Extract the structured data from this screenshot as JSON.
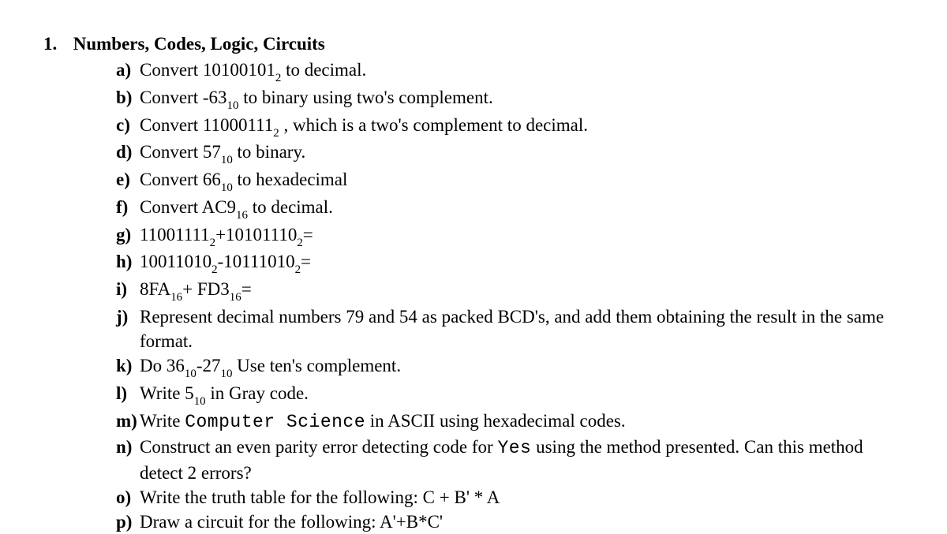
{
  "section": {
    "number": "1.",
    "title": "Numbers, Codes, Logic, Circuits"
  },
  "items": {
    "a": {
      "label": "a)",
      "pre": "Convert 10100101",
      "sub1": "2",
      "post": " to decimal."
    },
    "b": {
      "label": "b)",
      "pre": "Convert -63",
      "sub1": "10",
      "post": " to binary using two's complement."
    },
    "c": {
      "label": "c)",
      "pre": "Convert 11000111",
      "sub1": "2",
      "post": " , which is a  two's complement to decimal."
    },
    "d": {
      "label": "d)",
      "pre": "Convert 57",
      "sub1": "10",
      "post": " to binary."
    },
    "e": {
      "label": "e)",
      "pre": "Convert 66",
      "sub1": "10",
      "post": " to hexadecimal"
    },
    "f": {
      "label": "f)",
      "pre": "Convert  AC9",
      "sub1": "16",
      "post": " to decimal."
    },
    "g": {
      "label": "g)",
      "p1": "11001111",
      "s1": "2",
      "p2": "+10101110",
      "s2": "2",
      "p3": "="
    },
    "h": {
      "label": "h)",
      "p1": "10011010",
      "s1": "2",
      "p2": "-10111010",
      "s2": "2",
      "p3": "="
    },
    "i": {
      "label": "i)",
      "p1": "8FA",
      "s1": "16",
      "p2": "+ FD3",
      "s2": "16",
      "p3": "="
    },
    "j": {
      "label": "j)",
      "text": "Represent decimal numbers 79 and 54 as packed BCD's, and add them obtaining the result in the same format."
    },
    "k": {
      "label": "k)",
      "p1": "Do 36",
      "s1": "10",
      "p2": "-27",
      "s2": "10",
      "p3": " Use ten's complement."
    },
    "l": {
      "label": "l)",
      "pre": "Write 5",
      "sub1": "10",
      "post": " in Gray code."
    },
    "m": {
      "label": "m)",
      "pre": "Write ",
      "mono": "Computer Science",
      "post": "  in ASCII using hexadecimal codes."
    },
    "n": {
      "label": "n)",
      "pre": "Construct an even parity error detecting code for  ",
      "mono": "Yes",
      "post": "    using the method presented. Can this method detect 2 errors?"
    },
    "o": {
      "label": "o)",
      "text": "Write the truth table for the following: C + B'  * A"
    },
    "p": {
      "label": "p)",
      "text": "Draw a circuit for the following: A'+B*C'"
    }
  }
}
